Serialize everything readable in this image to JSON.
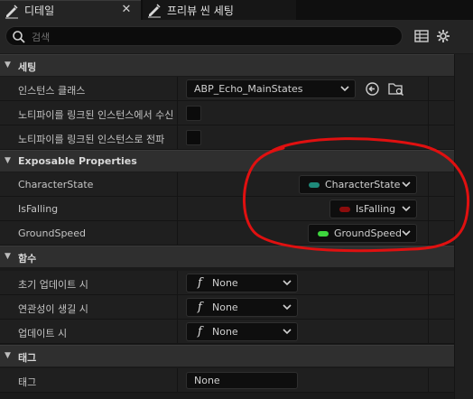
{
  "tabs": {
    "details_label": "디테일",
    "preview_label": "프리뷰 씬 세팅"
  },
  "search": {
    "placeholder": "검색"
  },
  "sections": {
    "settings": {
      "title": "세팅",
      "rows": {
        "instance_class": {
          "label": "인스턴스 클래스",
          "value": "ABP_Echo_MainStates"
        },
        "notify_receive": {
          "label": "노티파이를 링크된 인스턴스에서 수신"
        },
        "notify_propagate": {
          "label": "노티파이를 링크된 인스턴스로 전파"
        }
      }
    },
    "exposable": {
      "title": "Exposable Properties",
      "rows": {
        "character_state": {
          "label": "CharacterState",
          "pin_label": "CharacterState",
          "pin_color": "#1f8a7a"
        },
        "is_falling": {
          "label": "IsFalling",
          "pin_label": "IsFalling",
          "pin_color": "#8c0c0c"
        },
        "ground_speed": {
          "label": "GroundSpeed",
          "pin_label": "GroundSpeed",
          "pin_color": "#3ed63e"
        }
      }
    },
    "functions": {
      "title": "함수",
      "rows": {
        "initial_update": {
          "label": "초기 업데이트 시",
          "value": "None"
        },
        "become_relevant": {
          "label": "연관성이 생길 시",
          "value": "None"
        },
        "on_update": {
          "label": "업데이트 시",
          "value": "None"
        }
      }
    },
    "tags": {
      "title": "태그",
      "rows": {
        "tag": {
          "label": "태그",
          "value": "None"
        }
      }
    }
  },
  "annotation_color": "#e01010"
}
